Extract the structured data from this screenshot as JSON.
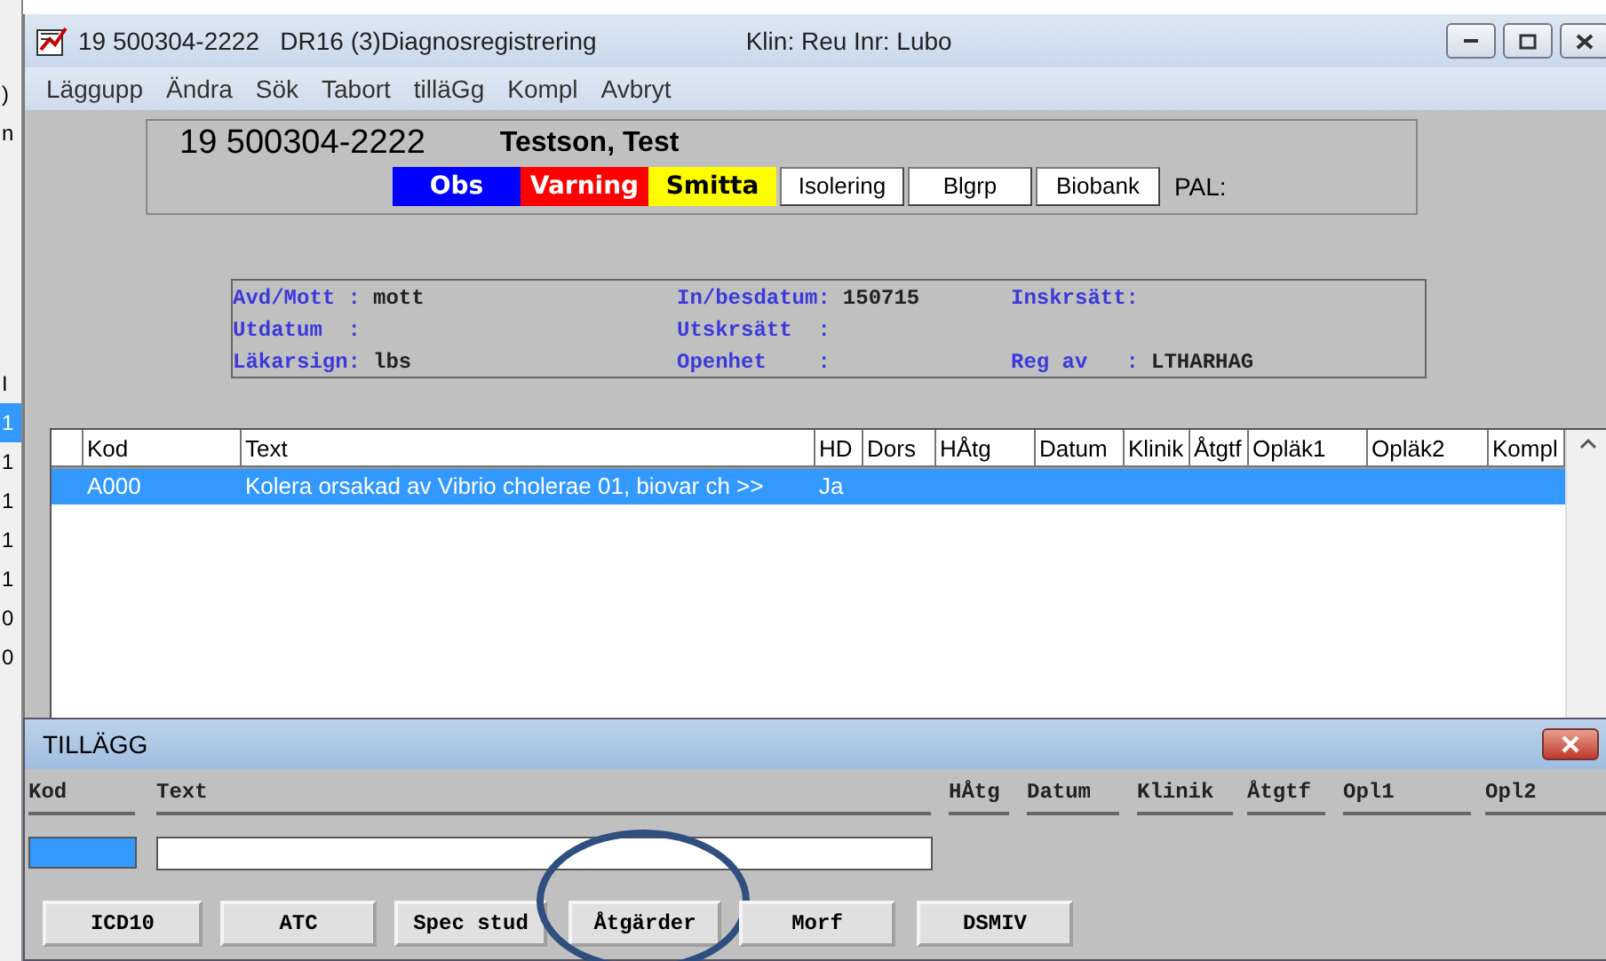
{
  "background_window": {
    "top_fragments": [
      ")",
      "n"
    ],
    "side_fragments": [
      {
        "text": "I",
        "selected": false
      },
      {
        "text": "1",
        "selected": true
      },
      {
        "text": "1",
        "selected": false
      },
      {
        "text": "1",
        "selected": false
      },
      {
        "text": "1",
        "selected": false
      },
      {
        "text": "1",
        "selected": false
      },
      {
        "text": "0",
        "selected": false
      },
      {
        "text": "0",
        "selected": false
      }
    ]
  },
  "window": {
    "title": "19 500304-2222   DR16 (3)Diagnosregistrering",
    "title_info": "Klin: Reu  Inr: Lubo"
  },
  "menu": [
    "Läggupp",
    "Ändra",
    "Sök",
    "Tabort",
    "tilläGg",
    "Kompl",
    "Avbryt"
  ],
  "patient": {
    "id": "19 500304-2222",
    "name": "Testson, Test",
    "flags": [
      {
        "label": "Obs",
        "color": "#0000ff"
      },
      {
        "label": "Varning",
        "color": "#ff0000"
      },
      {
        "label": "Smitta",
        "color": "#ffff00"
      }
    ],
    "buttons": [
      "Isolering",
      "Blgrp",
      "Biobank"
    ],
    "pal_label": "PAL:"
  },
  "info": [
    [
      {
        "label": "Avd/Mott :",
        "value": "mott"
      },
      {
        "label": "In/besdatum:",
        "value": "150715"
      },
      {
        "label": "Inskrsätt:"
      }
    ],
    [
      {
        "label": "Utdatum  :"
      },
      {
        "label": "Utskrsätt  :"
      }
    ],
    [
      {
        "label": "Läkarsign:",
        "value": "lbs"
      },
      {
        "label": "Openhet    :"
      },
      {
        "label": "Reg av   :",
        "value": "LTHARHAG"
      }
    ]
  ],
  "table": {
    "columns": [
      "Kod",
      "Text",
      "HD",
      "Dors",
      "HÅtg",
      "Datum",
      "Klinik",
      "Åtgtf",
      "Opläk1",
      "Opläk2",
      "Kompl"
    ],
    "rows": [
      {
        "selected": true,
        "cells": [
          "A000",
          "Kolera orsakad av Vibrio cholerae 01, biovar ch >>",
          "Ja",
          null,
          null,
          null,
          null,
          null,
          null,
          null,
          null
        ]
      }
    ]
  },
  "dialog": {
    "title": "TILLÄGG",
    "fields": [
      "Kod",
      "Text",
      "HÅtg",
      "Datum",
      "Klinik",
      "Åtgtf",
      "Opl1",
      "Opl2"
    ],
    "buttons": [
      {
        "label": "ICD10",
        "circled": false
      },
      {
        "label": "ATC",
        "circled": false
      },
      {
        "label": "Spec stud",
        "circled": false
      },
      {
        "label": "Åtgärder",
        "circled": true
      },
      {
        "label": "Morf",
        "circled": false
      },
      {
        "label": "DSMIV",
        "circled": false
      }
    ]
  }
}
